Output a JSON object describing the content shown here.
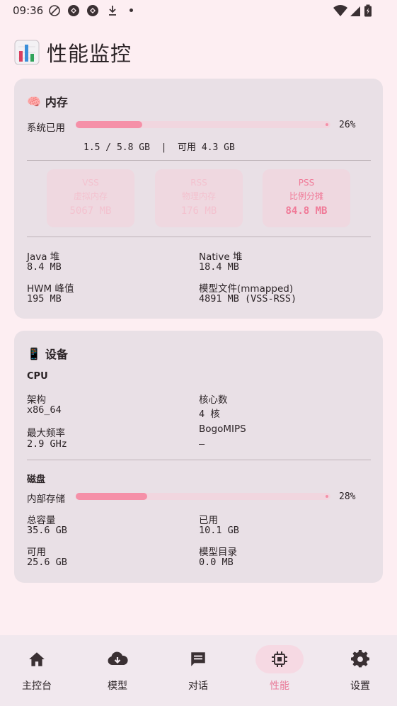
{
  "status_bar": {
    "time": "09:36",
    "icons": [
      "no-data-icon",
      "sync-icon",
      "sync-icon",
      "download-icon",
      "dot-icon",
      "wifi-icon",
      "signal-icon",
      "battery-icon"
    ]
  },
  "page": {
    "title_icon": "bar-chart-icon",
    "title": "性能监控"
  },
  "memory": {
    "emoji": "🧠",
    "title": "内存",
    "system_used_label": "系统已用",
    "system_used_fraction": 0.26,
    "system_used_pct": "26%",
    "usage_text": "1.5 / 5.8 GB  |  可用 4.3 GB",
    "chips": [
      {
        "key": "VSS",
        "name": "虚拟内存",
        "value": "5067 MB",
        "active": false
      },
      {
        "key": "RSS",
        "name": "物理内存",
        "value": "176 MB",
        "active": false
      },
      {
        "key": "PSS",
        "name": "比例分摊",
        "value": "84.8 MB",
        "active": true
      }
    ],
    "stats": {
      "java_heap_label": "Java 堆",
      "java_heap_value": "8.4 MB",
      "native_heap_label": "Native 堆",
      "native_heap_value": "18.4 MB",
      "hwm_label": "HWM 峰值",
      "hwm_value": "195 MB",
      "model_file_label": "模型文件(mmapped)",
      "model_file_value": "4891 MB (VSS-RSS)"
    }
  },
  "device": {
    "emoji": "📱",
    "title": "设备",
    "cpu_title": "CPU",
    "arch_label": "架构",
    "arch_value": "x86_64",
    "cores_label": "核心数",
    "cores_value": "4 核",
    "max_freq_label": "最大频率",
    "max_freq_value": "2.9 GHz",
    "bogomips_label": "BogoMIPS",
    "bogomips_value": "—",
    "disk_title": "磁盘",
    "internal_storage_label": "内部存储",
    "internal_storage_fraction": 0.28,
    "internal_storage_pct": "28%",
    "total_label": "总容量",
    "total_value": "35.6 GB",
    "used_label": "已用",
    "used_value": "10.1 GB",
    "available_label": "可用",
    "available_value": "25.6 GB",
    "model_dir_label": "模型目录",
    "model_dir_value": "0.0 MB"
  },
  "nav": {
    "items": [
      {
        "label": "主控台",
        "icon": "home-icon",
        "active": false
      },
      {
        "label": "模型",
        "icon": "cloud-download-icon",
        "active": false
      },
      {
        "label": "对话",
        "icon": "chat-icon",
        "active": false
      },
      {
        "label": "性能",
        "icon": "chip-icon",
        "active": true
      },
      {
        "label": "设置",
        "icon": "gear-icon",
        "active": false
      }
    ]
  },
  "colors": {
    "background": "#fdeef2",
    "card": "#e9e0e6",
    "accent": "#f590a8",
    "accent_text": "#e97a98"
  }
}
